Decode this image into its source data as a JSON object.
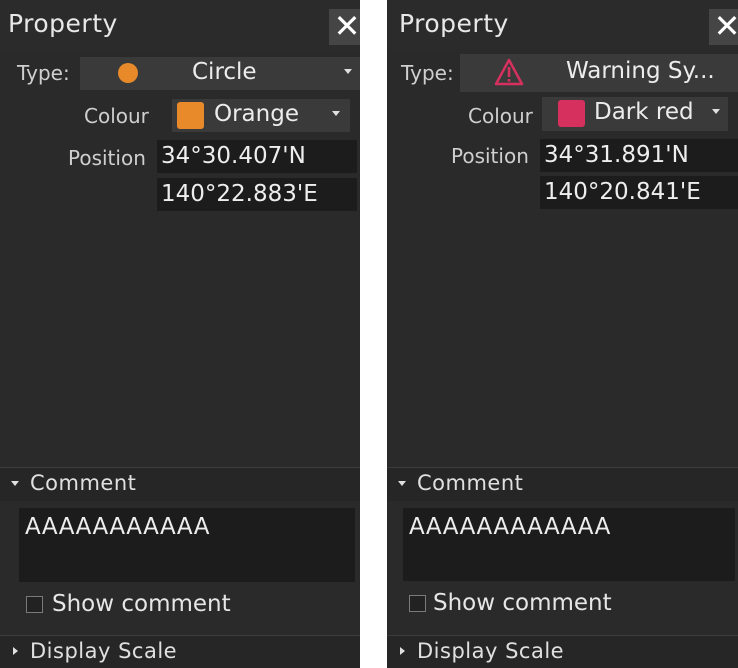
{
  "panels": [
    {
      "title": "Property",
      "close_icon": "✕",
      "type_label": "Type:",
      "type_value": "Circle",
      "type_icon": "orange-circle-icon",
      "colour_label": "Colour",
      "colour_value": "Orange",
      "colour_hex": "#e88a2a",
      "position_label": "Position",
      "latitude": "34°30.407'N",
      "longitude": "140°22.883'E",
      "comment_header": "Comment",
      "comment_text": "AAAAAAAAAAA",
      "show_comment_label": "Show comment",
      "display_scale_header": "Display Scale"
    },
    {
      "title": "Property",
      "close_icon": "✕",
      "type_label": "Type:",
      "type_value": "Warning Sy...",
      "type_icon": "warning-triangle-icon",
      "colour_label": "Colour",
      "colour_value": "Dark red",
      "colour_hex": "#d6305e",
      "position_label": "Position",
      "latitude": "34°31.891'N",
      "longitude": "140°20.841'E",
      "comment_header": "Comment",
      "comment_text": "AAAAAAAAAAAA",
      "show_comment_label": "Show comment",
      "display_scale_header": "Display Scale"
    }
  ]
}
